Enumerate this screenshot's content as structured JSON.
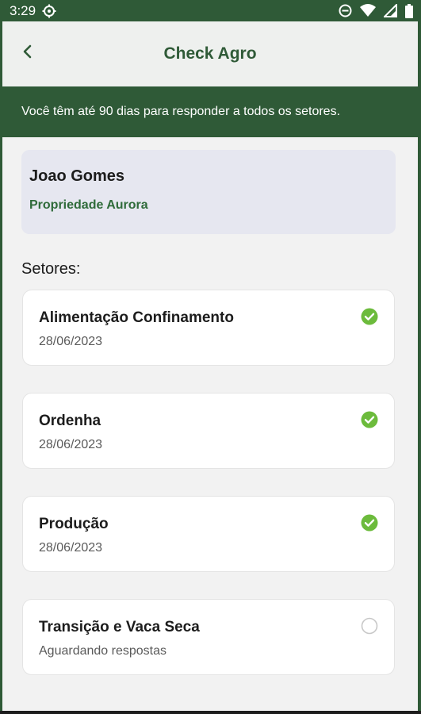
{
  "status_bar": {
    "time": "3:29"
  },
  "app_bar": {
    "title": "Check Agro"
  },
  "banner": {
    "text": "Você têm até 90 dias para responder a todos os setores."
  },
  "profile": {
    "name": "Joao Gomes",
    "property": "Propriedade Aurora"
  },
  "sectors_heading": "Setores:",
  "sectors": [
    {
      "title": "Alimentação Confinamento",
      "subtitle": "28/06/2023",
      "status": "check-circle-icon"
    },
    {
      "title": "Ordenha",
      "subtitle": "28/06/2023",
      "status": "check-circle-icon"
    },
    {
      "title": "Produção",
      "subtitle": "28/06/2023",
      "status": "check-circle-icon"
    },
    {
      "title": "Transição e Vaca Seca",
      "subtitle": "Aguardando respostas",
      "status": "empty-circle-icon"
    }
  ],
  "colors": {
    "brand_green": "#2f5a37",
    "check_green": "#6cbb3c",
    "pending_gray": "#c8c8c8"
  }
}
